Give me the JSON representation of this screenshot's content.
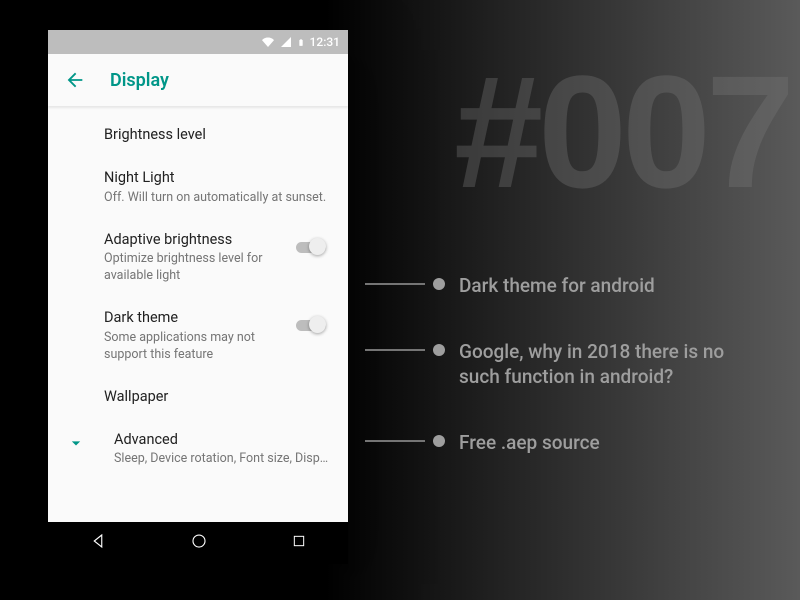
{
  "bg_number": "#007",
  "status": {
    "time": "12:31"
  },
  "appbar": {
    "title": "Display"
  },
  "settings": {
    "brightness": {
      "title": "Brightness level"
    },
    "night_light": {
      "title": "Night Light",
      "sub": "Off. Will turn on automatically at sunset."
    },
    "adaptive": {
      "title": "Adaptive brightness",
      "sub": "Optimize brightness level for available light"
    },
    "dark_theme": {
      "title": "Dark theme",
      "sub": "Some applications may not support this feature"
    },
    "wallpaper": {
      "title": "Wallpaper"
    },
    "advanced": {
      "title": "Advanced",
      "sub": "Sleep, Device rotation, Font size, Display si.."
    }
  },
  "callouts": {
    "c1": "Dark theme for android",
    "c2": "Google, why in 2018 there is no such function in android?",
    "c3": "Free .aep source"
  }
}
